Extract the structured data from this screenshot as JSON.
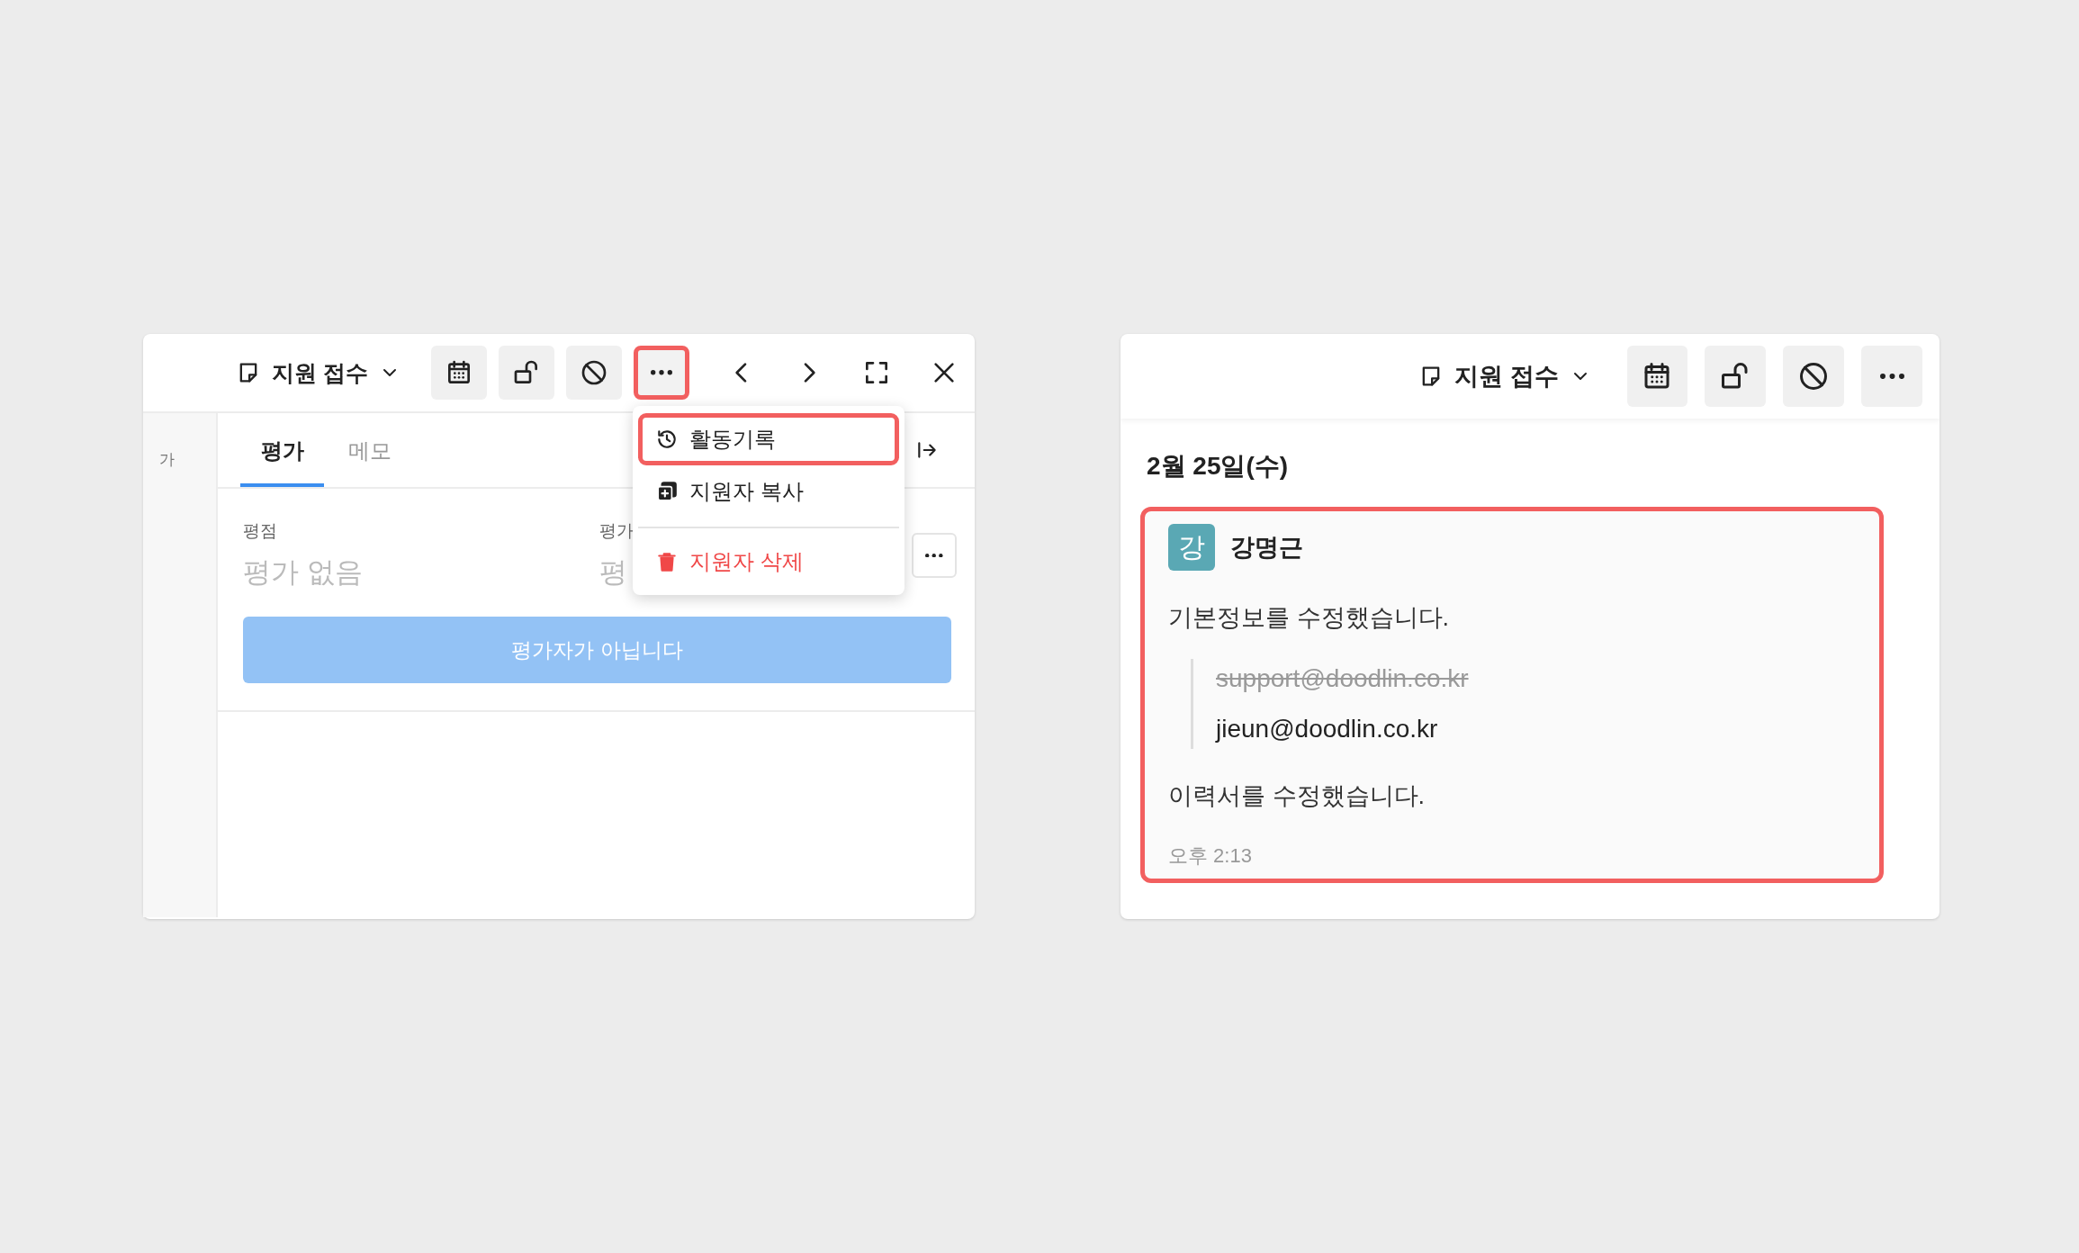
{
  "left_panel": {
    "header": {
      "status": "지원 접수",
      "tool_buttons": [
        {
          "kind": "calendar",
          "highlighted": false
        },
        {
          "kind": "unlock",
          "highlighted": false
        },
        {
          "kind": "block",
          "highlighted": false
        },
        {
          "kind": "more",
          "highlighted": true
        }
      ],
      "nav_buttons": [
        {
          "kind": "prev"
        },
        {
          "kind": "next"
        },
        {
          "kind": "expand"
        },
        {
          "kind": "close"
        }
      ]
    },
    "sidebar_label": "가",
    "tabs": [
      {
        "label": "평가",
        "selected": true
      },
      {
        "label": "메모",
        "selected": false
      }
    ],
    "fields": [
      {
        "label": "평점",
        "value": "평가 없음"
      },
      {
        "label": "평가",
        "value": "평"
      }
    ],
    "action_button": {
      "label": "평가자가 아닙니다",
      "disabled": true
    },
    "menu": {
      "items": [
        {
          "kind": "history",
          "label": "활동기록",
          "highlighted": true
        },
        {
          "kind": "copy",
          "label": "지원자 복사",
          "highlighted": false
        },
        {
          "kind": "delete",
          "label": "지원자 삭제",
          "highlighted": false
        }
      ]
    }
  },
  "right_panel": {
    "header": {
      "status": "지원 접수",
      "tool_buttons": [
        {
          "kind": "calendar",
          "highlighted": false
        },
        {
          "kind": "unlock",
          "highlighted": false
        },
        {
          "kind": "block",
          "highlighted": false
        },
        {
          "kind": "more",
          "highlighted": false
        }
      ]
    },
    "date": "2월 25일(수)",
    "activity": {
      "highlighted": true,
      "avatar": "강",
      "author": "강명근",
      "entries": [
        {
          "kind": "text",
          "text": "기본정보를 수정했습니다."
        },
        {
          "kind": "change",
          "old": "support@doodlin.co.kr",
          "new": "jieun@doodlin.co.kr"
        },
        {
          "kind": "text",
          "text": "이력서를 수정했습니다."
        }
      ],
      "time": "오후 2:13"
    }
  }
}
